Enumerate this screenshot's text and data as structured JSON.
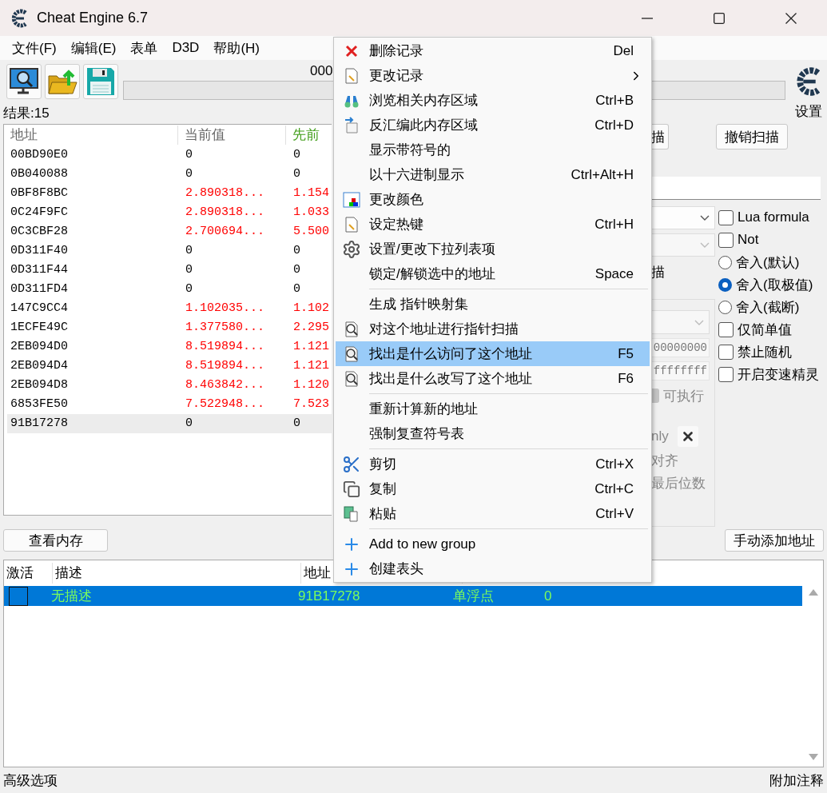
{
  "window": {
    "title": "Cheat Engine 6.7"
  },
  "menu_bar": [
    "文件(F)",
    "编辑(E)",
    "表单",
    "D3D",
    "帮助(H)"
  ],
  "toolbar": {
    "process": "000",
    "settings_label": "设置",
    "progress": {
      "level": 0
    }
  },
  "results": {
    "label": "结果:15",
    "columns": [
      "地址",
      "当前值",
      "先前"
    ],
    "rows": [
      {
        "address": "00BD90E0",
        "current": "0",
        "previous": "0",
        "changed": false,
        "selected": false
      },
      {
        "address": "0B040088",
        "current": "0",
        "previous": "0",
        "changed": false,
        "selected": false
      },
      {
        "address": "0BF8F8BC",
        "current": "2.890318...",
        "previous": "1.154",
        "changed": true,
        "selected": false
      },
      {
        "address": "0C24F9FC",
        "current": "2.890318...",
        "previous": "1.033",
        "changed": true,
        "selected": false
      },
      {
        "address": "0C3CBF28",
        "current": "2.700694...",
        "previous": "5.500",
        "changed": true,
        "selected": false
      },
      {
        "address": "0D311F40",
        "current": "0",
        "previous": "0",
        "changed": false,
        "selected": false
      },
      {
        "address": "0D311F44",
        "current": "0",
        "previous": "0",
        "changed": false,
        "selected": false
      },
      {
        "address": "0D311FD4",
        "current": "0",
        "previous": "0",
        "changed": false,
        "selected": false
      },
      {
        "address": "147C9CC4",
        "current": "1.102035...",
        "previous": "1.102",
        "changed": true,
        "selected": false
      },
      {
        "address": "1ECFE49C",
        "current": "1.377580...",
        "previous": "2.295",
        "changed": true,
        "selected": false
      },
      {
        "address": "2EB094D0",
        "current": "8.519894...",
        "previous": "1.121",
        "changed": true,
        "selected": false
      },
      {
        "address": "2EB094D4",
        "current": "8.519894...",
        "previous": "1.121",
        "changed": true,
        "selected": false
      },
      {
        "address": "2EB094D8",
        "current": "8.463842...",
        "previous": "1.120",
        "changed": true,
        "selected": false
      },
      {
        "address": "6853FE50",
        "current": "7.522948...",
        "previous": "7.523",
        "changed": true,
        "selected": false
      },
      {
        "address": "91B17278",
        "current": "0",
        "previous": "0",
        "changed": false,
        "selected": true
      }
    ]
  },
  "scan_panel": {
    "scan_button": "描",
    "undo_scan_button": "撤销扫描",
    "scan_label": "描",
    "dropdowns": [
      {
        "disabled": false
      },
      {
        "disabled": true
      }
    ],
    "memory_start": "00000000",
    "memory_stop": "ffffffff",
    "executable_label": "可执行",
    "executable_checked": true,
    "readonly_partial": "nly",
    "alignment_partial": "对齐",
    "last_digits_partial": "最后位数",
    "options": [
      {
        "kind": "checkbox",
        "label": "Lua formula",
        "checked": false
      },
      {
        "kind": "checkbox",
        "label": "Not",
        "checked": false
      },
      {
        "kind": "radio",
        "label": "舍入(默认)",
        "selected": false
      },
      {
        "kind": "radio",
        "label": "舍入(取极值)",
        "selected": true
      },
      {
        "kind": "radio",
        "label": "舍入(截断)",
        "selected": false
      },
      {
        "kind": "checkbox",
        "label": "仅简单值",
        "checked": false
      },
      {
        "kind": "checkbox",
        "label": "禁止随机",
        "checked": false
      },
      {
        "kind": "checkbox",
        "label": "开启变速精灵",
        "checked": false
      }
    ]
  },
  "buttons": {
    "view_memory": "查看内存",
    "add_address": "手动添加地址"
  },
  "address_list": {
    "columns": [
      "激活",
      "描述",
      "地址"
    ],
    "rows": [
      {
        "active": false,
        "description": "无描述",
        "address": "91B17278",
        "type": "单浮点",
        "value": "0",
        "selected": true
      }
    ]
  },
  "status_bar": {
    "left": "高级选项",
    "right": "附加注释"
  },
  "context_menu": {
    "groups": [
      [
        {
          "label": "删除记录",
          "shortcut": "Del",
          "has_submenu": false,
          "selected": false
        },
        {
          "label": "更改记录",
          "has_submenu": true,
          "selected": false
        },
        {
          "label": "浏览相关内存区域",
          "shortcut": "Ctrl+B",
          "has_submenu": false,
          "selected": false
        },
        {
          "label": "反汇编此内存区域",
          "shortcut": "Ctrl+D",
          "has_submenu": false,
          "selected": false
        },
        {
          "label": "显示带符号的",
          "has_submenu": false,
          "selected": false
        },
        {
          "label": "以十六进制显示",
          "shortcut": "Ctrl+Alt+H",
          "has_submenu": false,
          "selected": false
        },
        {
          "label": "更改颜色",
          "has_submenu": false,
          "selected": false
        },
        {
          "label": "设定热键",
          "shortcut": "Ctrl+H",
          "has_submenu": false,
          "selected": false
        },
        {
          "label": "设置/更改下拉列表项",
          "has_submenu": false,
          "selected": false
        },
        {
          "label": "锁定/解锁选中的地址",
          "shortcut": "Space",
          "has_submenu": false,
          "selected": false
        }
      ],
      [
        {
          "label": "生成 指针映射集",
          "has_submenu": false,
          "selected": false
        },
        {
          "label": "对这个地址进行指针扫描",
          "has_submenu": false,
          "selected": false
        },
        {
          "label": "找出是什么访问了这个地址",
          "shortcut": "F5",
          "has_submenu": false,
          "selected": true
        },
        {
          "label": "找出是什么改写了这个地址",
          "shortcut": "F6",
          "has_submenu": false,
          "selected": false
        }
      ],
      [
        {
          "label": "重新计算新的地址",
          "has_submenu": false,
          "selected": false
        },
        {
          "label": "强制复查符号表",
          "has_submenu": false,
          "selected": false
        }
      ],
      [
        {
          "label": "剪切",
          "shortcut": "Ctrl+X",
          "has_submenu": false,
          "selected": false
        },
        {
          "label": "复制",
          "shortcut": "Ctrl+C",
          "has_submenu": false,
          "selected": false
        },
        {
          "label": "粘贴",
          "shortcut": "Ctrl+V",
          "has_submenu": false,
          "selected": false
        }
      ],
      [
        {
          "label": "Add to new group",
          "has_submenu": false,
          "selected": false
        },
        {
          "label": "创建表头",
          "has_submenu": false,
          "selected": false
        }
      ]
    ]
  }
}
